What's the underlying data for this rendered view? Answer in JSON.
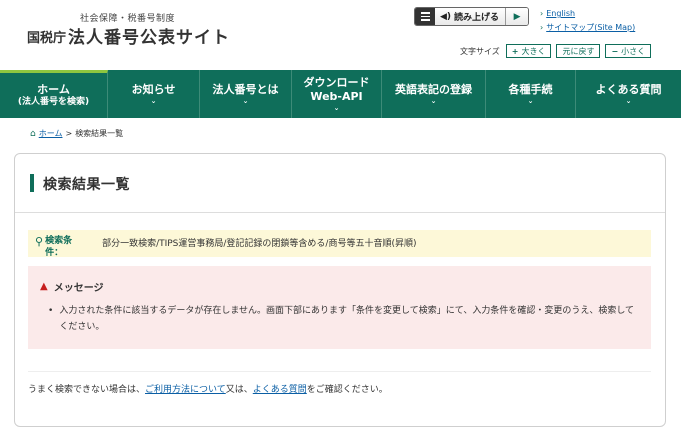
{
  "header": {
    "subtitle": "社会保障・税番号制度",
    "agency": "国税庁",
    "site_name": "法人番号公表サイト",
    "readspeaker": {
      "label": "読み上げる",
      "play_icon": "play-icon",
      "speaker_icon": "speaker-icon",
      "menu_icon": "menu-icon"
    },
    "links": {
      "english": "English",
      "sitemap": "サイトマップ(Site Map)"
    },
    "fontsize": {
      "label": "文字サイズ",
      "larger": "大きく",
      "reset": "元に戻す",
      "smaller": "小さく",
      "plus": "+",
      "minus": "−"
    }
  },
  "nav": {
    "home": "ホーム",
    "home_sub": "(法人番号を検索)",
    "news": "お知らせ",
    "about": "法人番号とは",
    "download": "ダウンロード",
    "download_sub": "Web-API",
    "english_reg": "英語表記の登録",
    "procedures": "各種手続",
    "faq": "よくある質問"
  },
  "breadcrumb": {
    "home": "ホーム",
    "separator": ">",
    "current": "検索結果一覧"
  },
  "main": {
    "title": "検索結果一覧",
    "condition_label": "検索条件：",
    "condition_value": "部分一致検索/TIPS運営事務局/登記記録の閉鎖等含める/商号等五十音順(昇順)",
    "message_title": "メッセージ",
    "message_text": "入力された条件に該当するデータが存在しません。画面下部にあります「条件を変更して検索」にて、入力条件を確認・変更のうえ、検索してください。",
    "footer": {
      "prefix": "うまく検索できない場合は、",
      "link1": "ご利用方法について",
      "middle": "又は、",
      "link2": "よくある質問",
      "suffix": "をご確認ください。"
    }
  },
  "colors": {
    "brand": "#0f6e5a",
    "accent": "#8ec63f",
    "link": "#0b5fa5",
    "warning": "#c61f1f"
  }
}
